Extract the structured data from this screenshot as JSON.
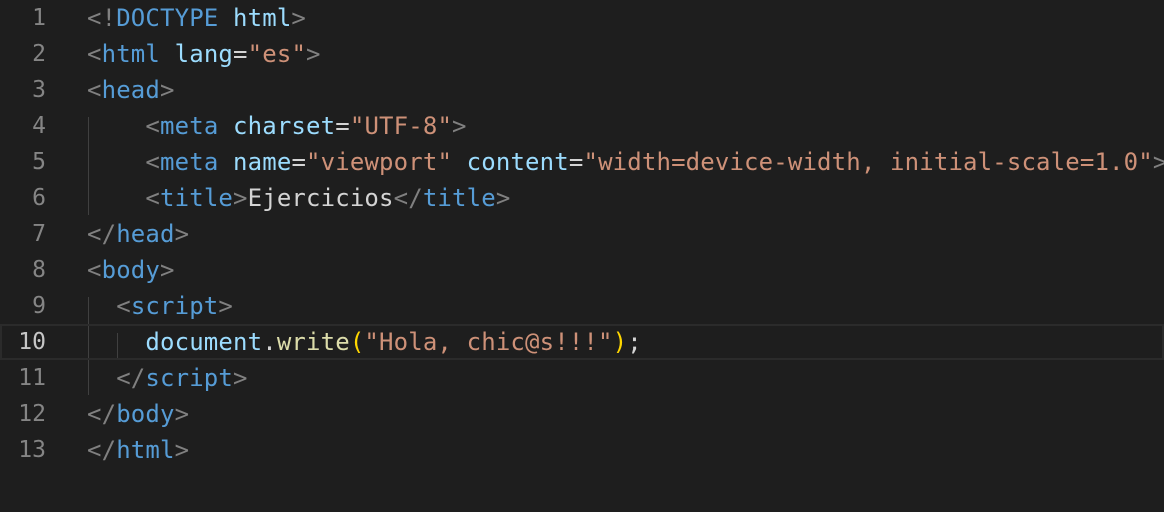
{
  "editor": {
    "colors": {
      "background": "#1e1e1e",
      "line_number": "#858585",
      "line_number_active": "#c6c6c6",
      "tag": "#569cd6",
      "attribute": "#9cdcfe",
      "string": "#ce9178",
      "punctuation": "#808080",
      "function": "#dcdcaa",
      "bracket": "#ffd700"
    },
    "active_line": "10",
    "lines": [
      {
        "number": "1",
        "tokens": [
          {
            "t": "<!",
            "c": "punc"
          },
          {
            "t": "DOCTYPE",
            "c": "tag"
          },
          {
            "t": " ",
            "c": "plain"
          },
          {
            "t": "html",
            "c": "attr"
          },
          {
            "t": ">",
            "c": "punc"
          }
        ]
      },
      {
        "number": "2",
        "tokens": [
          {
            "t": "<",
            "c": "punc"
          },
          {
            "t": "html",
            "c": "tag"
          },
          {
            "t": " ",
            "c": "plain"
          },
          {
            "t": "lang",
            "c": "attr"
          },
          {
            "t": "=",
            "c": "eq"
          },
          {
            "t": "\"es\"",
            "c": "str"
          },
          {
            "t": ">",
            "c": "punc"
          }
        ]
      },
      {
        "number": "3",
        "tokens": [
          {
            "t": "<",
            "c": "punc"
          },
          {
            "t": "head",
            "c": "tag"
          },
          {
            "t": ">",
            "c": "punc"
          }
        ]
      },
      {
        "number": "4",
        "tokens": [
          {
            "t": "    ",
            "c": "plain"
          },
          {
            "t": "<",
            "c": "punc"
          },
          {
            "t": "meta",
            "c": "tag"
          },
          {
            "t": " ",
            "c": "plain"
          },
          {
            "t": "charset",
            "c": "attr"
          },
          {
            "t": "=",
            "c": "eq"
          },
          {
            "t": "\"UTF-8\"",
            "c": "str"
          },
          {
            "t": ">",
            "c": "punc"
          }
        ]
      },
      {
        "number": "5",
        "tokens": [
          {
            "t": "    ",
            "c": "plain"
          },
          {
            "t": "<",
            "c": "punc"
          },
          {
            "t": "meta",
            "c": "tag"
          },
          {
            "t": " ",
            "c": "plain"
          },
          {
            "t": "name",
            "c": "attr"
          },
          {
            "t": "=",
            "c": "eq"
          },
          {
            "t": "\"viewport\"",
            "c": "str"
          },
          {
            "t": " ",
            "c": "plain"
          },
          {
            "t": "content",
            "c": "attr"
          },
          {
            "t": "=",
            "c": "eq"
          },
          {
            "t": "\"width=device-width, initial-scale=1.0\"",
            "c": "str"
          },
          {
            "t": ">",
            "c": "punc"
          }
        ]
      },
      {
        "number": "6",
        "tokens": [
          {
            "t": "    ",
            "c": "plain"
          },
          {
            "t": "<",
            "c": "punc"
          },
          {
            "t": "title",
            "c": "tag"
          },
          {
            "t": ">",
            "c": "punc"
          },
          {
            "t": "Ejercicios",
            "c": "plain"
          },
          {
            "t": "</",
            "c": "punc"
          },
          {
            "t": "title",
            "c": "tag"
          },
          {
            "t": ">",
            "c": "punc"
          }
        ]
      },
      {
        "number": "7",
        "tokens": [
          {
            "t": "</",
            "c": "punc"
          },
          {
            "t": "head",
            "c": "tag"
          },
          {
            "t": ">",
            "c": "punc"
          }
        ]
      },
      {
        "number": "8",
        "tokens": [
          {
            "t": "<",
            "c": "punc"
          },
          {
            "t": "body",
            "c": "tag"
          },
          {
            "t": ">",
            "c": "punc"
          }
        ]
      },
      {
        "number": "9",
        "tokens": [
          {
            "t": "  ",
            "c": "plain"
          },
          {
            "t": "<",
            "c": "punc"
          },
          {
            "t": "script",
            "c": "tag"
          },
          {
            "t": ">",
            "c": "punc"
          }
        ]
      },
      {
        "number": "10",
        "tokens": [
          {
            "t": "    ",
            "c": "plain"
          },
          {
            "t": "document",
            "c": "var"
          },
          {
            "t": ".",
            "c": "plain"
          },
          {
            "t": "write",
            "c": "fn"
          },
          {
            "t": "(",
            "c": "paren"
          },
          {
            "t": "\"Hola, chic@s!!!\"",
            "c": "str"
          },
          {
            "t": ")",
            "c": "paren"
          },
          {
            "t": ";",
            "c": "plain"
          }
        ]
      },
      {
        "number": "11",
        "tokens": [
          {
            "t": "  ",
            "c": "plain"
          },
          {
            "t": "</",
            "c": "punc"
          },
          {
            "t": "script",
            "c": "tag"
          },
          {
            "t": ">",
            "c": "punc"
          }
        ]
      },
      {
        "number": "12",
        "tokens": [
          {
            "t": "</",
            "c": "punc"
          },
          {
            "t": "body",
            "c": "tag"
          },
          {
            "t": ">",
            "c": "punc"
          }
        ]
      },
      {
        "number": "13",
        "tokens": [
          {
            "t": "</",
            "c": "punc"
          },
          {
            "t": "html",
            "c": "tag"
          },
          {
            "t": ">",
            "c": "punc"
          }
        ]
      }
    ]
  }
}
